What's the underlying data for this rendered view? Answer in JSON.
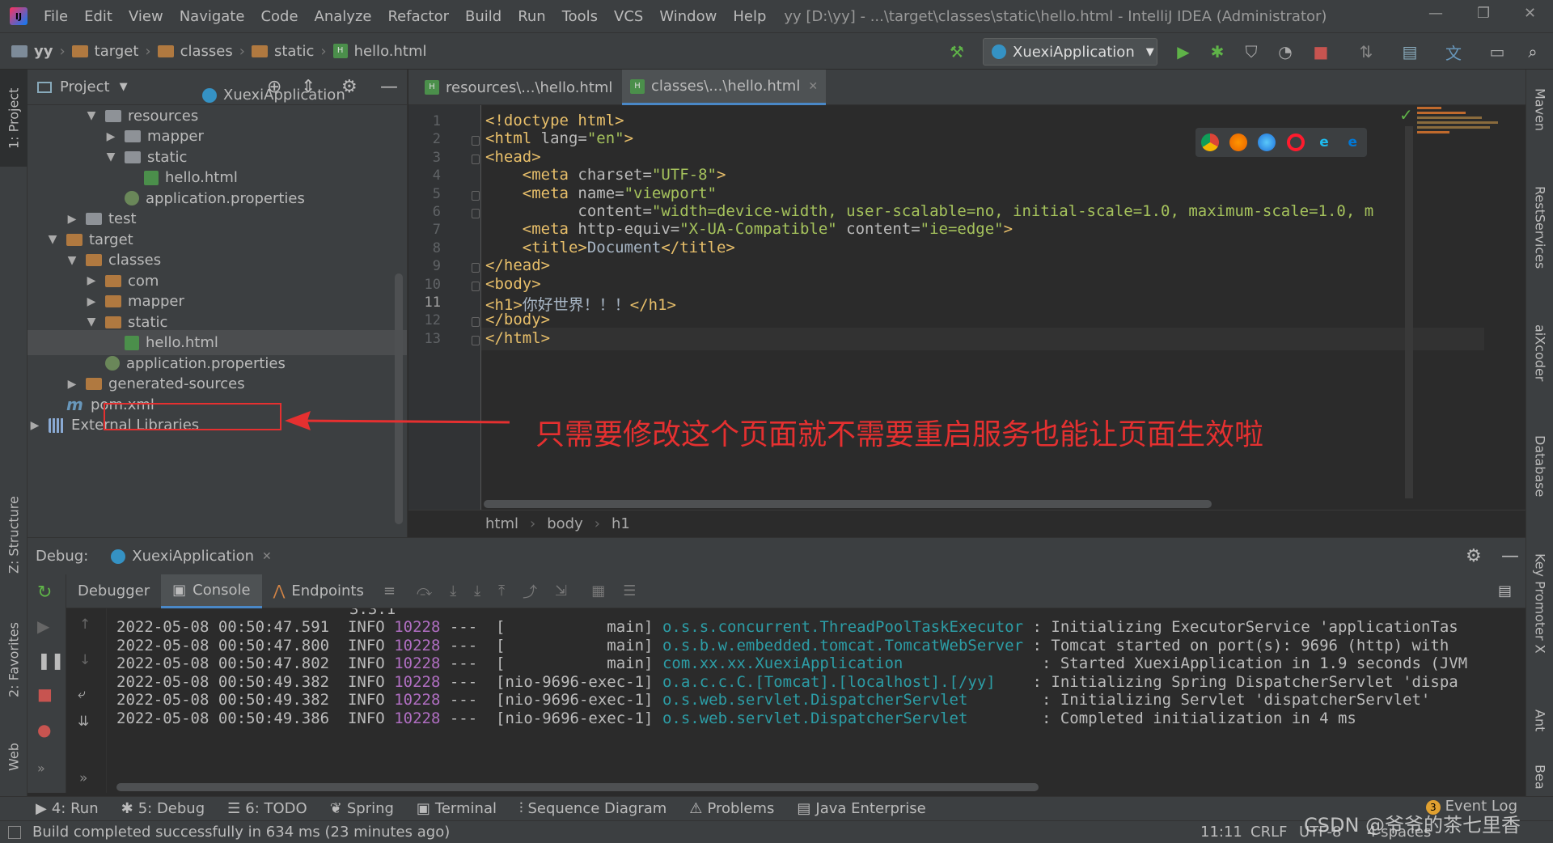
{
  "window": {
    "menu": [
      "File",
      "Edit",
      "View",
      "Navigate",
      "Code",
      "Analyze",
      "Refactor",
      "Build",
      "Run",
      "Tools",
      "VCS",
      "Window",
      "Help"
    ],
    "title": "yy [D:\\yy] - ...\\target\\classes\\static\\hello.html - IntelliJ IDEA (Administrator)"
  },
  "navbar": {
    "crumbs": [
      "yy",
      "target",
      "classes",
      "static",
      "hello.html"
    ],
    "run_config": "XuexiApplication"
  },
  "project": {
    "header": "Project",
    "tree": [
      {
        "label": "XuexiApplication",
        "icon": "spring-app-icon",
        "arrow": ""
      },
      {
        "label": "resources",
        "icon": "folder-grey",
        "arrow": "▼"
      },
      {
        "label": "mapper",
        "icon": "folder-grey",
        "arrow": "▶"
      },
      {
        "label": "static",
        "icon": "folder-grey",
        "arrow": "▼"
      },
      {
        "label": "hello.html",
        "icon": "html-file-icon",
        "arrow": ""
      },
      {
        "label": "application.properties",
        "icon": "properties-icon",
        "arrow": ""
      },
      {
        "label": "test",
        "icon": "folder-grey",
        "arrow": "▶"
      },
      {
        "label": "target",
        "icon": "folder-orange",
        "arrow": "▼"
      },
      {
        "label": "classes",
        "icon": "folder-orange",
        "arrow": "▼"
      },
      {
        "label": "com",
        "icon": "folder-orange",
        "arrow": "▶"
      },
      {
        "label": "mapper",
        "icon": "folder-orange",
        "arrow": "▶"
      },
      {
        "label": "static",
        "icon": "folder-orange",
        "arrow": "▼"
      },
      {
        "label": "hello.html",
        "icon": "html-file-icon",
        "arrow": ""
      },
      {
        "label": "application.properties",
        "icon": "properties-icon",
        "arrow": ""
      },
      {
        "label": "generated-sources",
        "icon": "folder-orange",
        "arrow": "▶"
      },
      {
        "label": "pom.xml",
        "icon": "maven-icon",
        "arrow": ""
      },
      {
        "label": "External Libraries",
        "icon": "library-icon",
        "arrow": "▶"
      }
    ]
  },
  "editor": {
    "tabs": [
      "resources\\...\\hello.html",
      "classes\\...\\hello.html"
    ],
    "lines": [
      {
        "n": "1",
        "parts": [
          [
            "tag",
            "<!doctype html>"
          ]
        ]
      },
      {
        "n": "2",
        "parts": [
          [
            "tag",
            "<html "
          ],
          [
            "attr",
            "lang="
          ],
          [
            "val",
            "\"en\""
          ],
          [
            "tag",
            ">"
          ]
        ]
      },
      {
        "n": "3",
        "parts": [
          [
            "tag",
            "<head>"
          ]
        ]
      },
      {
        "n": "4",
        "parts": [
          [
            "tag",
            "    <meta "
          ],
          [
            "attr",
            "charset="
          ],
          [
            "val",
            "\"UTF-8\""
          ],
          [
            "tag",
            ">"
          ]
        ]
      },
      {
        "n": "5",
        "parts": [
          [
            "tag",
            "    <meta "
          ],
          [
            "attr",
            "name="
          ],
          [
            "val",
            "\"viewport\""
          ]
        ]
      },
      {
        "n": "6",
        "parts": [
          [
            "attr",
            "          content="
          ],
          [
            "val",
            "\"width=device-width, user-scalable=no, initial-scale=1.0, maximum-scale=1.0, m"
          ]
        ]
      },
      {
        "n": "7",
        "parts": [
          [
            "tag",
            "    <meta "
          ],
          [
            "attr",
            "http-equiv="
          ],
          [
            "val",
            "\"X-UA-Compatible\" "
          ],
          [
            "attr",
            "content="
          ],
          [
            "val",
            "\"ie=edge\""
          ],
          [
            "tag",
            ">"
          ]
        ]
      },
      {
        "n": "8",
        "parts": [
          [
            "tag",
            "    <title>"
          ],
          [
            "txt",
            "Document"
          ],
          [
            "tag",
            "</title>"
          ]
        ]
      },
      {
        "n": "9",
        "parts": [
          [
            "tag",
            "</head>"
          ]
        ]
      },
      {
        "n": "10",
        "parts": [
          [
            "tag",
            "<body>"
          ]
        ]
      },
      {
        "n": "11",
        "parts": [
          [
            "tag",
            "<h1>"
          ],
          [
            "txt",
            "你好世界！！！"
          ],
          [
            "tag",
            "</h1>"
          ]
        ]
      },
      {
        "n": "12",
        "parts": [
          [
            "tag",
            "</body>"
          ]
        ]
      },
      {
        "n": "13",
        "parts": [
          [
            "tag",
            "</html>"
          ]
        ]
      }
    ],
    "breadcrumbs": [
      "html",
      "body",
      "h1"
    ],
    "annotation": "只需要修改这个页面就不需要重启服务也能让页面生效啦"
  },
  "debug": {
    "label": "Debug:",
    "config": "XuexiApplication",
    "tabs": [
      "Debugger",
      "Console",
      "Endpoints"
    ],
    "logs": [
      {
        "ts": "2022-05-08 00:50:47.591",
        "level": "INFO",
        "pid": "10228",
        "thread": "---  [           main]",
        "logger": "o.s.s.concurrent.ThreadPoolTaskExecutor",
        "msg": ": Initializing ExecutorService 'applicationTas"
      },
      {
        "ts": "2022-05-08 00:50:47.800",
        "level": "INFO",
        "pid": "10228",
        "thread": "---  [           main]",
        "logger": "o.s.b.w.embedded.tomcat.TomcatWebServer",
        "msg": ": Tomcat started on port(s): 9696 (http) with "
      },
      {
        "ts": "2022-05-08 00:50:47.802",
        "level": "INFO",
        "pid": "10228",
        "thread": "---  [           main]",
        "logger": "com.xx.xx.XuexiApplication              ",
        "msg": ": Started XuexiApplication in 1.9 seconds (JVM"
      },
      {
        "ts": "2022-05-08 00:50:49.382",
        "level": "INFO",
        "pid": "10228",
        "thread": "---  [nio-9696-exec-1]",
        "logger": "o.a.c.c.C.[Tomcat].[localhost].[/yy]   ",
        "msg": ": Initializing Spring DispatcherServlet 'dispa"
      },
      {
        "ts": "2022-05-08 00:50:49.382",
        "level": "INFO",
        "pid": "10228",
        "thread": "---  [nio-9696-exec-1]",
        "logger": "o.s.web.servlet.DispatcherServlet       ",
        "msg": ": Initializing Servlet 'dispatcherServlet'"
      },
      {
        "ts": "2022-05-08 00:50:49.386",
        "level": "INFO",
        "pid": "10228",
        "thread": "---  [nio-9696-exec-1]",
        "logger": "o.s.web.servlet.DispatcherServlet       ",
        "msg": ": Completed initialization in 4 ms"
      }
    ]
  },
  "bottom_tools": [
    {
      "icon": "play-icon",
      "label": "4: Run"
    },
    {
      "icon": "bug-icon",
      "label": "5: Debug"
    },
    {
      "icon": "list-icon",
      "label": "6: TODO"
    },
    {
      "icon": "spring-icon",
      "label": "Spring"
    },
    {
      "icon": "terminal-icon",
      "label": "Terminal"
    },
    {
      "icon": "sequence-icon",
      "label": "Sequence Diagram"
    },
    {
      "icon": "warning-icon",
      "label": "Problems"
    },
    {
      "icon": "java-ee-icon",
      "label": "Java Enterprise"
    }
  ],
  "event_log": {
    "badge": "3",
    "label": "Event Log"
  },
  "status": {
    "message": "Build completed successfully in 634 ms (23 minutes ago)",
    "position": "11:11",
    "line_sep": "CRLF",
    "encoding": "UTF-8",
    "indent": "4 spaces"
  },
  "left_stripe": [
    "1: Project",
    "Z: Structure",
    "2: Favorites",
    "Web"
  ],
  "right_stripe": [
    "Maven",
    "RestServices",
    "aiXcoder",
    "Database",
    "Key Promoter X",
    "Ant",
    "Bea"
  ],
  "watermark": "CSDN @爷爷的茶七里香"
}
